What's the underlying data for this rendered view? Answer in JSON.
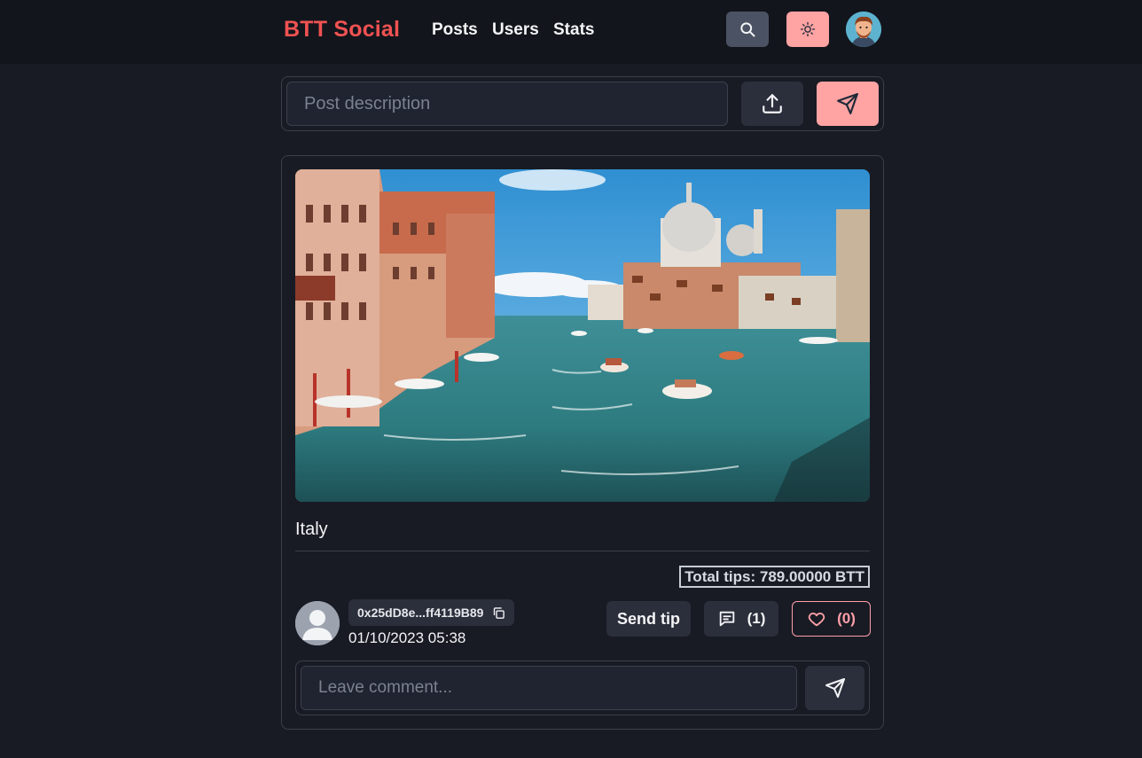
{
  "nav": {
    "brand": "BTT Social",
    "links": [
      "Posts",
      "Users",
      "Stats"
    ],
    "icons": {
      "search": "search-icon",
      "theme": "sun-icon",
      "profile": "avatar"
    },
    "colors": {
      "brand": "#f05252",
      "accent": "#ffa3a3",
      "search_bg": "#4a5263"
    }
  },
  "composer": {
    "placeholder": "Post description",
    "upload_icon": "upload-icon",
    "send_icon": "send-icon"
  },
  "post": {
    "image_subject": "Venice Grand Canal",
    "caption": "Italy",
    "tips": "Total tips: 789.00000 BTT",
    "author_address": "0x25dD8e...ff4119B89",
    "date": "01/10/2023 05:38",
    "send_tip_label": "Send tip",
    "comment_count": "(1)",
    "like_count": "(0)",
    "comment_placeholder": "Leave comment..."
  }
}
